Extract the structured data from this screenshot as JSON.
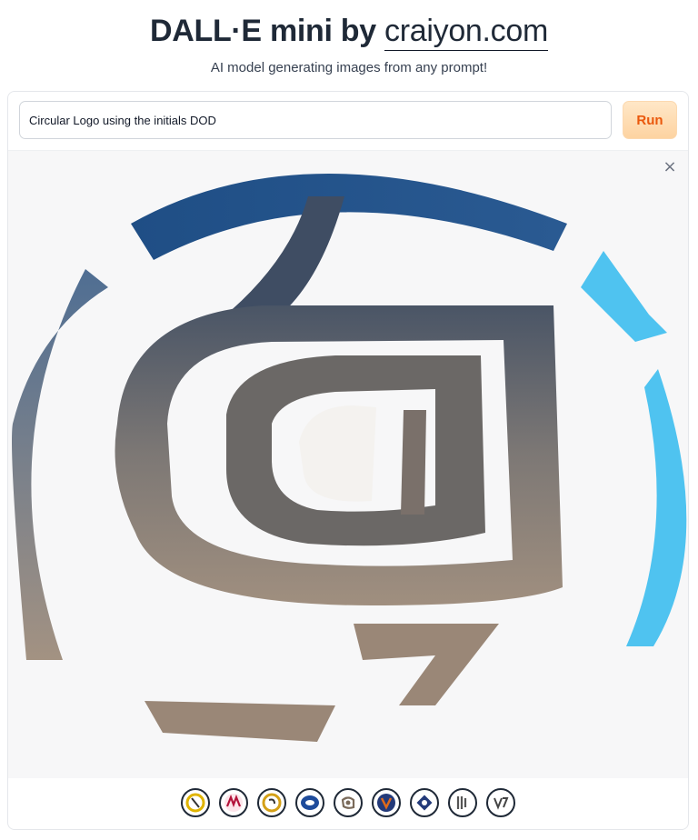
{
  "header": {
    "title_prefix": "DALL·E mini by ",
    "title_link": "craiyon.com",
    "subtitle": "AI model generating images from any prompt!"
  },
  "prompt": {
    "value": "Circular Logo using the initials DOD",
    "run_label": "Run"
  },
  "gallery": {
    "close_icon": "×",
    "image_alt": "generated circular logo",
    "thumbnails": [
      {
        "name": "thumb-1",
        "accent": "#e0b400"
      },
      {
        "name": "thumb-2",
        "accent": "#b3123a"
      },
      {
        "name": "thumb-3",
        "accent": "#d4a017"
      },
      {
        "name": "thumb-4",
        "accent": "#1e4b9b"
      },
      {
        "name": "thumb-5",
        "accent": "#7a6a5a"
      },
      {
        "name": "thumb-6",
        "accent": "#e06a1b"
      },
      {
        "name": "thumb-7",
        "accent": "#233a7a"
      },
      {
        "name": "thumb-8",
        "accent": "#555555"
      },
      {
        "name": "thumb-9",
        "accent": "#444444"
      }
    ]
  },
  "colors": {
    "run_text": "#ea580c",
    "logo_blue_dark": "#1f4e85",
    "logo_blue_light": "#4fc3f0",
    "logo_gradient_top": "#4a5566",
    "logo_gradient_bottom": "#a08f7f"
  }
}
